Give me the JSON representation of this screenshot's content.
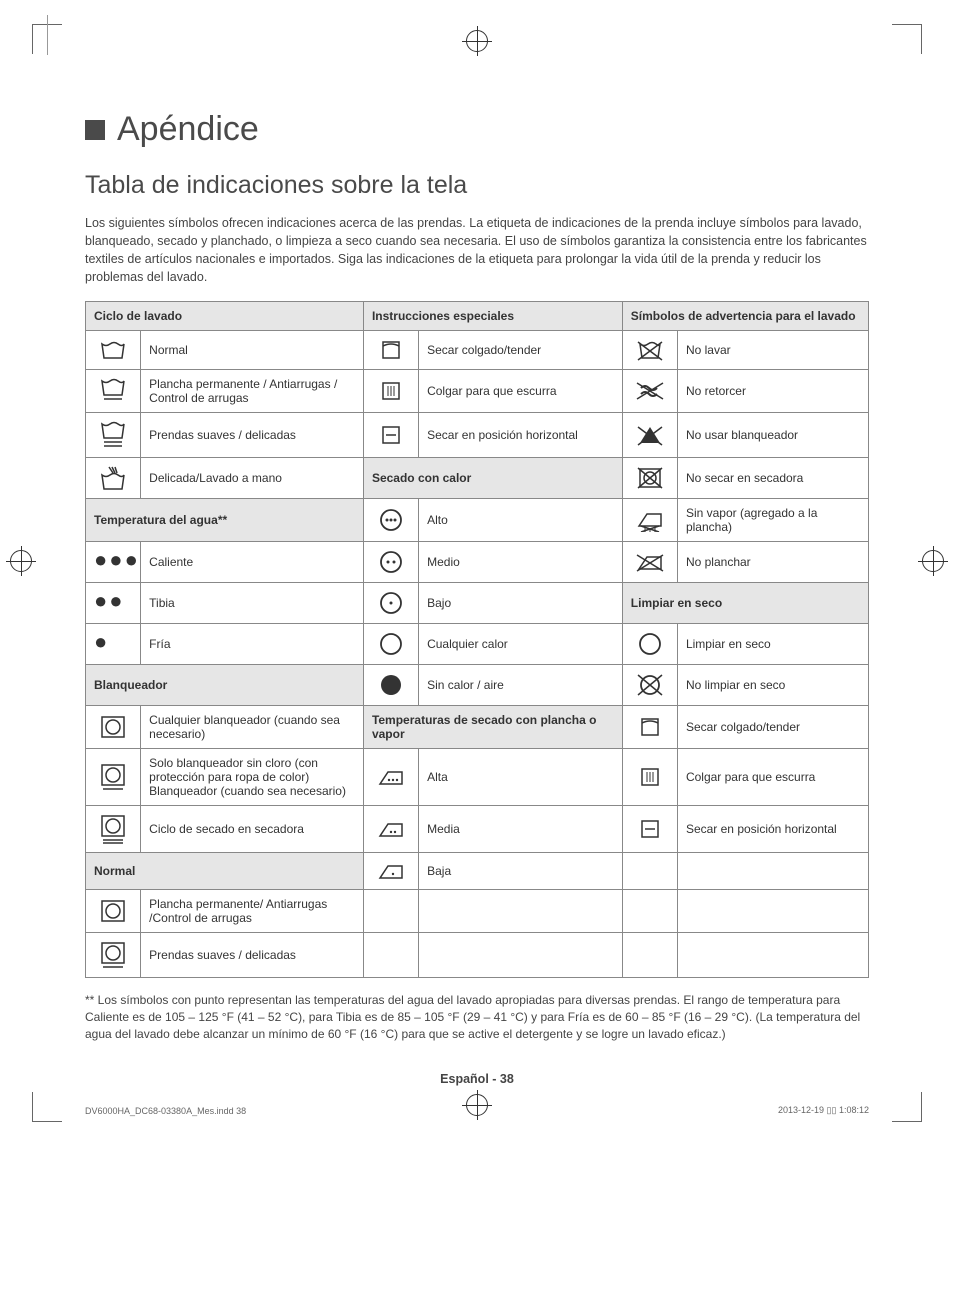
{
  "section_title": "Apéndice",
  "subsection_title": "Tabla de indicaciones sobre la tela",
  "intro_text": "Los siguientes símbolos ofrecen indicaciones acerca de las prendas. La etiqueta de indicaciones de la prenda incluye símbolos para lavado, blanqueado, secado y planchado, o limpieza a seco cuando sea necesaria. El uso de símbolos garantiza la consistencia entre los fabricantes textiles de artículos nacionales e importados. Siga las indicaciones de la etiqueta para prolongar la vida útil de la prenda y reducir los problemas del lavado.",
  "headers": {
    "col1": "Ciclo de lavado",
    "col2": "Instrucciones especiales",
    "col3": "Símbolos de advertencia para el lavado"
  },
  "subheaders": {
    "water_temp": "Temperatura del agua**",
    "bleach": "Blanqueador",
    "normal": "Normal",
    "heat_dry": "Secado con calor",
    "iron_temp": "Temperaturas de secado con plancha o vapor",
    "dry_clean": "Limpiar en seco"
  },
  "rows": {
    "r1c1": "Normal",
    "r1c2": "Secar colgado/tender",
    "r1c3": "No lavar",
    "r2c1": "Plancha permanente / Antiarrugas / Control de arrugas",
    "r2c2": "Colgar para que escurra",
    "r2c3": "No retorcer",
    "r3c1": "Prendas suaves / delicadas",
    "r3c2": "Secar en posición horizontal",
    "r3c3": "No usar blanqueador",
    "r4c1": "Delicada/Lavado a mano",
    "r4c3": "No secar en secadora",
    "r5c2": "Alto",
    "r5c3": "Sin vapor (agregado a la plancha)",
    "r6c1": "Caliente",
    "r6c2": "Medio",
    "r6c3": "No planchar",
    "r7c1": "Tibia",
    "r7c2": "Bajo",
    "r8c1": "Fría",
    "r8c2": "Cualquier calor",
    "r8c3": "Limpiar en seco",
    "r9c2": "Sin calor / aire",
    "r9c3": "No limpiar en seco",
    "r10c1": "Cualquier blanqueador (cuando sea necesario)",
    "r10c3": "Secar colgado/tender",
    "r11c1": "Solo blanqueador sin cloro (con protección para ropa de color) Blanqueador (cuando sea necesario)",
    "r11c2": "Alta",
    "r11c3": "Colgar para que escurra",
    "r12c1": "Ciclo de secado en secadora",
    "r12c2": "Media",
    "r12c3": "Secar en posición horizontal",
    "r13c2": "Baja",
    "r14c1": "Plancha permanente/ Antiarrugas /Control de arrugas",
    "r15c1": "Prendas suaves / delicadas"
  },
  "footnote": "** Los símbolos con punto representan las temperaturas del agua del lavado apropiadas para diversas prendas. El rango de temperatura para Caliente es de 105 – 125 °F (41 – 52 °C), para Tibia es de 85 – 105 °F (29 – 41 °C) y para Fría es de 60 – 85 °F (16 – 29 °C). (La temperatura del agua del lavado debe alcanzar un mínimo de 60 °F (16 °C) para que se active el detergente y se logre un lavado eficaz.)",
  "page_footer": "Español - 38",
  "print_footer_left": "DV6000HA_DC68-03380A_Mes.indd   38",
  "print_footer_right": "2013-12-19   ▯▯ 1:08:12"
}
